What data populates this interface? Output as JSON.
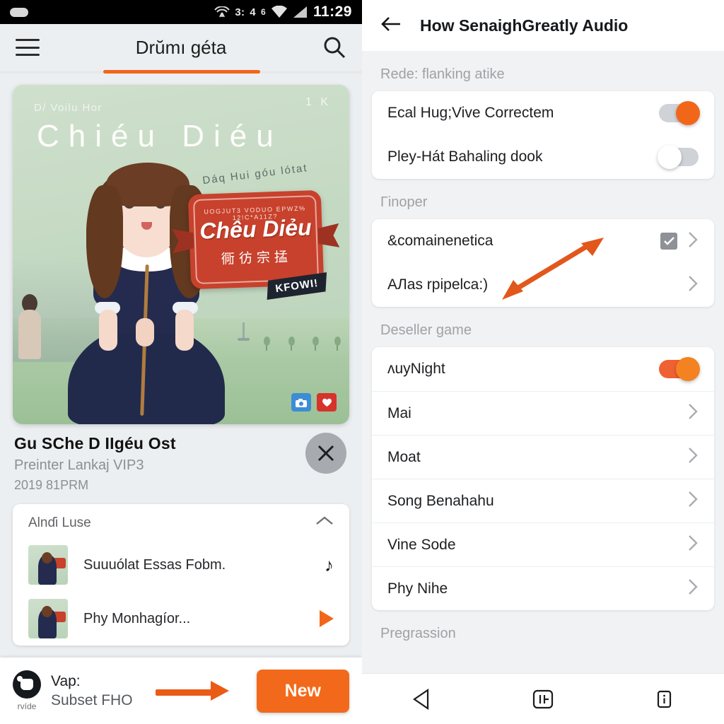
{
  "left": {
    "statusbar": {
      "indicator1": "3:",
      "indicator2": "4",
      "indicator3": "6",
      "clock": "11:29"
    },
    "appbar": {
      "title": "Drŭmı géta",
      "menu_icon": "hamburger-menu-icon",
      "search_icon": "search-icon"
    },
    "album_art": {
      "credit": "D/ Voilu Hor",
      "corner_badge": "1 K",
      "title": "Chiéu Diéu",
      "arc_text": "Dáq Hui góu lótat",
      "emblem_sub": "UOGJUT3 VODUO EPWZ% 12!C*A11Z?",
      "emblem_name": "Chêu Diẻu",
      "emblem_cjk": "衕彷宗掹",
      "emblem_ribbon": "KFOWI!",
      "badge_icons": [
        "camera-icon",
        "heart-icon"
      ]
    },
    "meta": {
      "title": "Gu SChe D IIgéu Ost",
      "subtitle": "Preinter Lankaj VIP3",
      "date": "2019 81PRM",
      "close_icon": "close-icon"
    },
    "list_card": {
      "header": "Alnɗi Luse",
      "collapse_icon": "chevron-up-icon",
      "rows": [
        {
          "label": "Suuuólat Essas Fobm.",
          "action_icon": "music-note-icon"
        },
        {
          "label": "Phy Monhagíor...",
          "action_icon": "play-icon"
        }
      ]
    },
    "mini_player": {
      "avatar_label": "rvíde",
      "line1": "Vap:",
      "line2": "Subset FHO",
      "cta_label": "New"
    }
  },
  "right": {
    "appbar": {
      "back_icon": "back-arrow-icon",
      "title": "How SenaighGreatly Audio"
    },
    "sections": [
      {
        "header": "Rede: flanking atike",
        "rows": [
          {
            "label": "Ecal Hug;Vive Correctem",
            "control": "toggle",
            "state": "on"
          },
          {
            "label": "Pley-Hát Bahaling dook",
            "control": "toggle",
            "state": "off"
          }
        ]
      },
      {
        "header": "Гinoper",
        "rows": [
          {
            "label": "&comainenetica",
            "control": "checkbox-chevron",
            "state": "checked"
          },
          {
            "label": "AЛas rpipelca:)",
            "control": "chevron",
            "state": ""
          }
        ]
      },
      {
        "header": "Deseller game",
        "rows": [
          {
            "label": "ʌuyNight",
            "control": "toggle",
            "state": "on"
          },
          {
            "label": "Mai",
            "control": "chevron",
            "state": ""
          },
          {
            "label": "Moat",
            "control": "chevron",
            "state": ""
          },
          {
            "label": "Song Benahahu",
            "control": "chevron",
            "state": ""
          },
          {
            "label": "Vine Sode",
            "control": "chevron",
            "state": ""
          },
          {
            "label": "Phy Nihe",
            "control": "chevron",
            "state": ""
          }
        ]
      },
      {
        "header": "Pregrassion",
        "rows": []
      }
    ],
    "navbar": {
      "back_icon": "nav-back-triangle-icon",
      "home_icon": "nav-recent-icon",
      "info_icon": "nav-info-icon"
    }
  },
  "colors": {
    "accent": "#f2661a",
    "arrow": "#ea5c16",
    "card": "#ffffff",
    "bg": "#f1f2f4"
  }
}
